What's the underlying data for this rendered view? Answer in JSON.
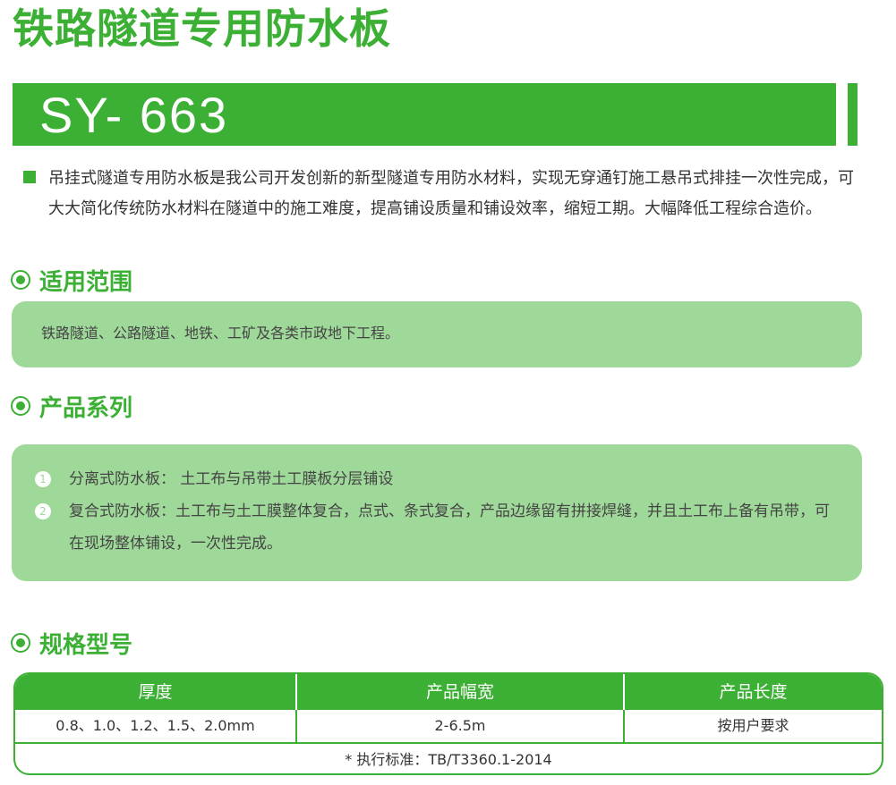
{
  "title": "铁路隧道专用防水板",
  "model": "SY- 663",
  "intro": "吊挂式隧道专用防水板是我公司开发创新的新型隧道专用防水材料，实现无穿通钉施工悬吊式排挂一次性完成，可大大简化传统防水材料在隧道中的施工难度，提高铺设质量和铺设效率，缩短工期。大幅降低工程综合造价。",
  "sections": {
    "scope": {
      "title": "适用范围",
      "text": "铁路隧道、公路隧道、地铁、工矿及各类市政地下工程。"
    },
    "series": {
      "title": "产品系列",
      "items": [
        {
          "num": "1",
          "text": "分离式防水板： 土工布与吊带土工膜板分层铺设"
        },
        {
          "num": "2",
          "text": "复合式防水板：土工布与土工膜整体复合，点式、条式复合，产品边缘留有拼接焊缝，并且土工布上备有吊带，可在现场整体铺设，一次性完成。"
        }
      ]
    },
    "spec": {
      "title": "规格型号",
      "headers": [
        "厚度",
        "产品幅宽",
        "产品长度"
      ],
      "row": [
        "0.8、1.0、1.2、1.5、2.0mm",
        "2-6.5m",
        "按用户要求"
      ],
      "footnote": "* 执行标准：TB/T3360.1-2014"
    }
  },
  "colors": {
    "accent": "#3cb034",
    "panel": "#9fd999"
  }
}
